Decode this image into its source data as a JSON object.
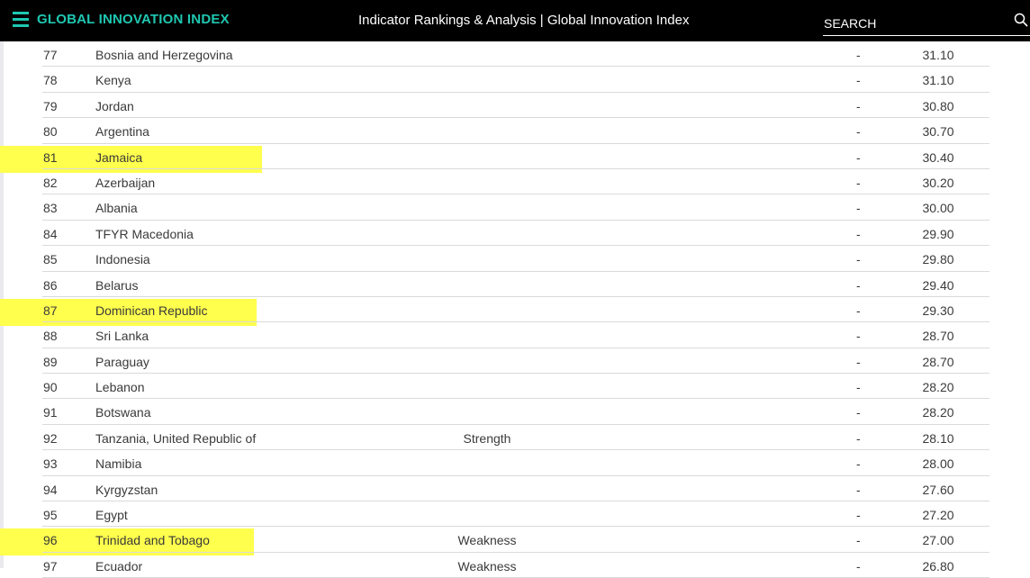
{
  "header": {
    "brand": "GLOBAL INNOVATION INDEX",
    "title": "Indicator Rankings & Analysis | Global Innovation Index",
    "search_placeholder": "SEARCH",
    "accent_color": "#1fc7b1",
    "icons": [
      "menu-icon",
      "search-icon"
    ]
  },
  "highlight_color": "#ffff4d",
  "rows": [
    {
      "rank": "77",
      "country": "Bosnia and Herzegovina",
      "tag": "",
      "change": "-",
      "score": "31.10",
      "highlighted": false
    },
    {
      "rank": "78",
      "country": "Kenya",
      "tag": "",
      "change": "-",
      "score": "31.10",
      "highlighted": false
    },
    {
      "rank": "79",
      "country": "Jordan",
      "tag": "",
      "change": "-",
      "score": "30.80",
      "highlighted": false
    },
    {
      "rank": "80",
      "country": "Argentina",
      "tag": "",
      "change": "-",
      "score": "30.70",
      "highlighted": false
    },
    {
      "rank": "81",
      "country": "Jamaica",
      "tag": "",
      "change": "-",
      "score": "30.40",
      "highlighted": true
    },
    {
      "rank": "82",
      "country": "Azerbaijan",
      "tag": "",
      "change": "-",
      "score": "30.20",
      "highlighted": false
    },
    {
      "rank": "83",
      "country": "Albania",
      "tag": "",
      "change": "-",
      "score": "30.00",
      "highlighted": false
    },
    {
      "rank": "84",
      "country": "TFYR Macedonia",
      "tag": "",
      "change": "-",
      "score": "29.90",
      "highlighted": false
    },
    {
      "rank": "85",
      "country": "Indonesia",
      "tag": "",
      "change": "-",
      "score": "29.80",
      "highlighted": false
    },
    {
      "rank": "86",
      "country": "Belarus",
      "tag": "",
      "change": "-",
      "score": "29.40",
      "highlighted": false
    },
    {
      "rank": "87",
      "country": "Dominican Republic",
      "tag": "",
      "change": "-",
      "score": "29.30",
      "highlighted": true
    },
    {
      "rank": "88",
      "country": "Sri Lanka",
      "tag": "",
      "change": "-",
      "score": "28.70",
      "highlighted": false
    },
    {
      "rank": "89",
      "country": "Paraguay",
      "tag": "",
      "change": "-",
      "score": "28.70",
      "highlighted": false
    },
    {
      "rank": "90",
      "country": "Lebanon",
      "tag": "",
      "change": "-",
      "score": "28.20",
      "highlighted": false
    },
    {
      "rank": "91",
      "country": "Botswana",
      "tag": "",
      "change": "-",
      "score": "28.20",
      "highlighted": false
    },
    {
      "rank": "92",
      "country": "Tanzania, United Republic of",
      "tag": "Strength",
      "change": "-",
      "score": "28.10",
      "highlighted": false
    },
    {
      "rank": "93",
      "country": "Namibia",
      "tag": "",
      "change": "-",
      "score": "28.00",
      "highlighted": false
    },
    {
      "rank": "94",
      "country": "Kyrgyzstan",
      "tag": "",
      "change": "-",
      "score": "27.60",
      "highlighted": false
    },
    {
      "rank": "95",
      "country": "Egypt",
      "tag": "",
      "change": "-",
      "score": "27.20",
      "highlighted": false
    },
    {
      "rank": "96",
      "country": "Trinidad and Tobago",
      "tag": "Weakness",
      "change": "-",
      "score": "27.00",
      "highlighted": true
    },
    {
      "rank": "97",
      "country": "Ecuador",
      "tag": "Weakness",
      "change": "-",
      "score": "26.80",
      "highlighted": false
    }
  ]
}
